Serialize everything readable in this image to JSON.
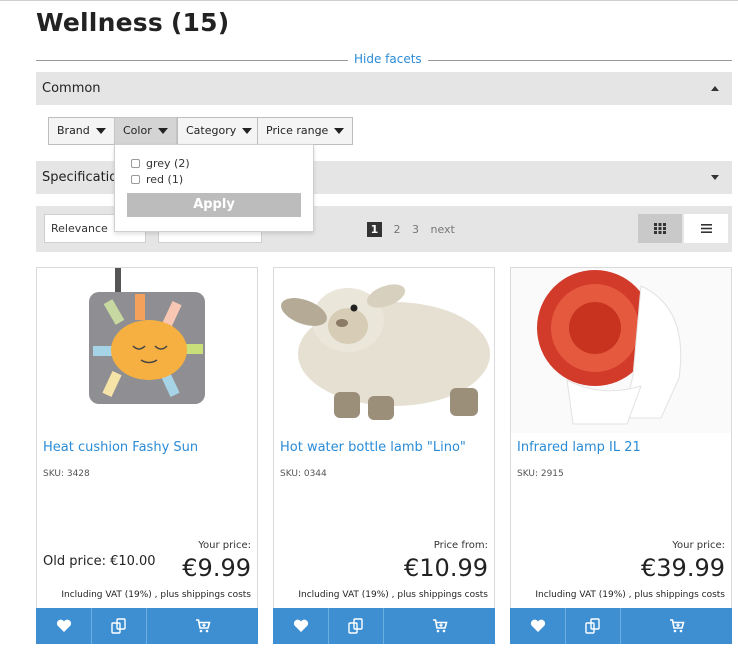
{
  "page": {
    "title": "Wellness",
    "count": "(15)"
  },
  "facets": {
    "hide_label": "Hide facets",
    "common_label": "Common",
    "spec_label": "Specification",
    "buttons": [
      "Brand",
      "Color",
      "Category",
      "Price range"
    ],
    "color_options": [
      {
        "label": "grey (2)",
        "checked": false
      },
      {
        "label": "red (1)",
        "checked": false
      }
    ],
    "apply_label": "Apply"
  },
  "sort": {
    "selected": "Relevance",
    "pages": [
      "1",
      "2",
      "3"
    ],
    "next_label": "next",
    "current_page": "1"
  },
  "icons": {
    "grid": "grid-view-icon",
    "list": "list-view-icon",
    "wishlist": "heart-icon",
    "compare": "compare-icon",
    "cart": "cart-icon"
  },
  "colors": {
    "accent": "#2a8bd6",
    "action_bar": "#3d8fd2",
    "bar_bg": "#e5e5e5"
  },
  "products": [
    {
      "title": "Heat cushion Fashy Sun",
      "sku": "SKU: 3428",
      "price_label": "Your price:",
      "price": "€9.99",
      "old_price": "Old price:   €10.00",
      "vat": "Including VAT (19%) , plus shippings costs"
    },
    {
      "title": "Hot water bottle lamb \"Lino\"",
      "sku": "SKU: 0344",
      "price_label": "Price from:",
      "price": "€10.99",
      "vat": "Including VAT (19%) , plus shippings costs"
    },
    {
      "title": "Infrared lamp IL 21",
      "sku": "SKU: 2915",
      "price_label": "Your price:",
      "price": "€39.99",
      "vat": "Including VAT (19%) , plus shippings costs"
    }
  ]
}
